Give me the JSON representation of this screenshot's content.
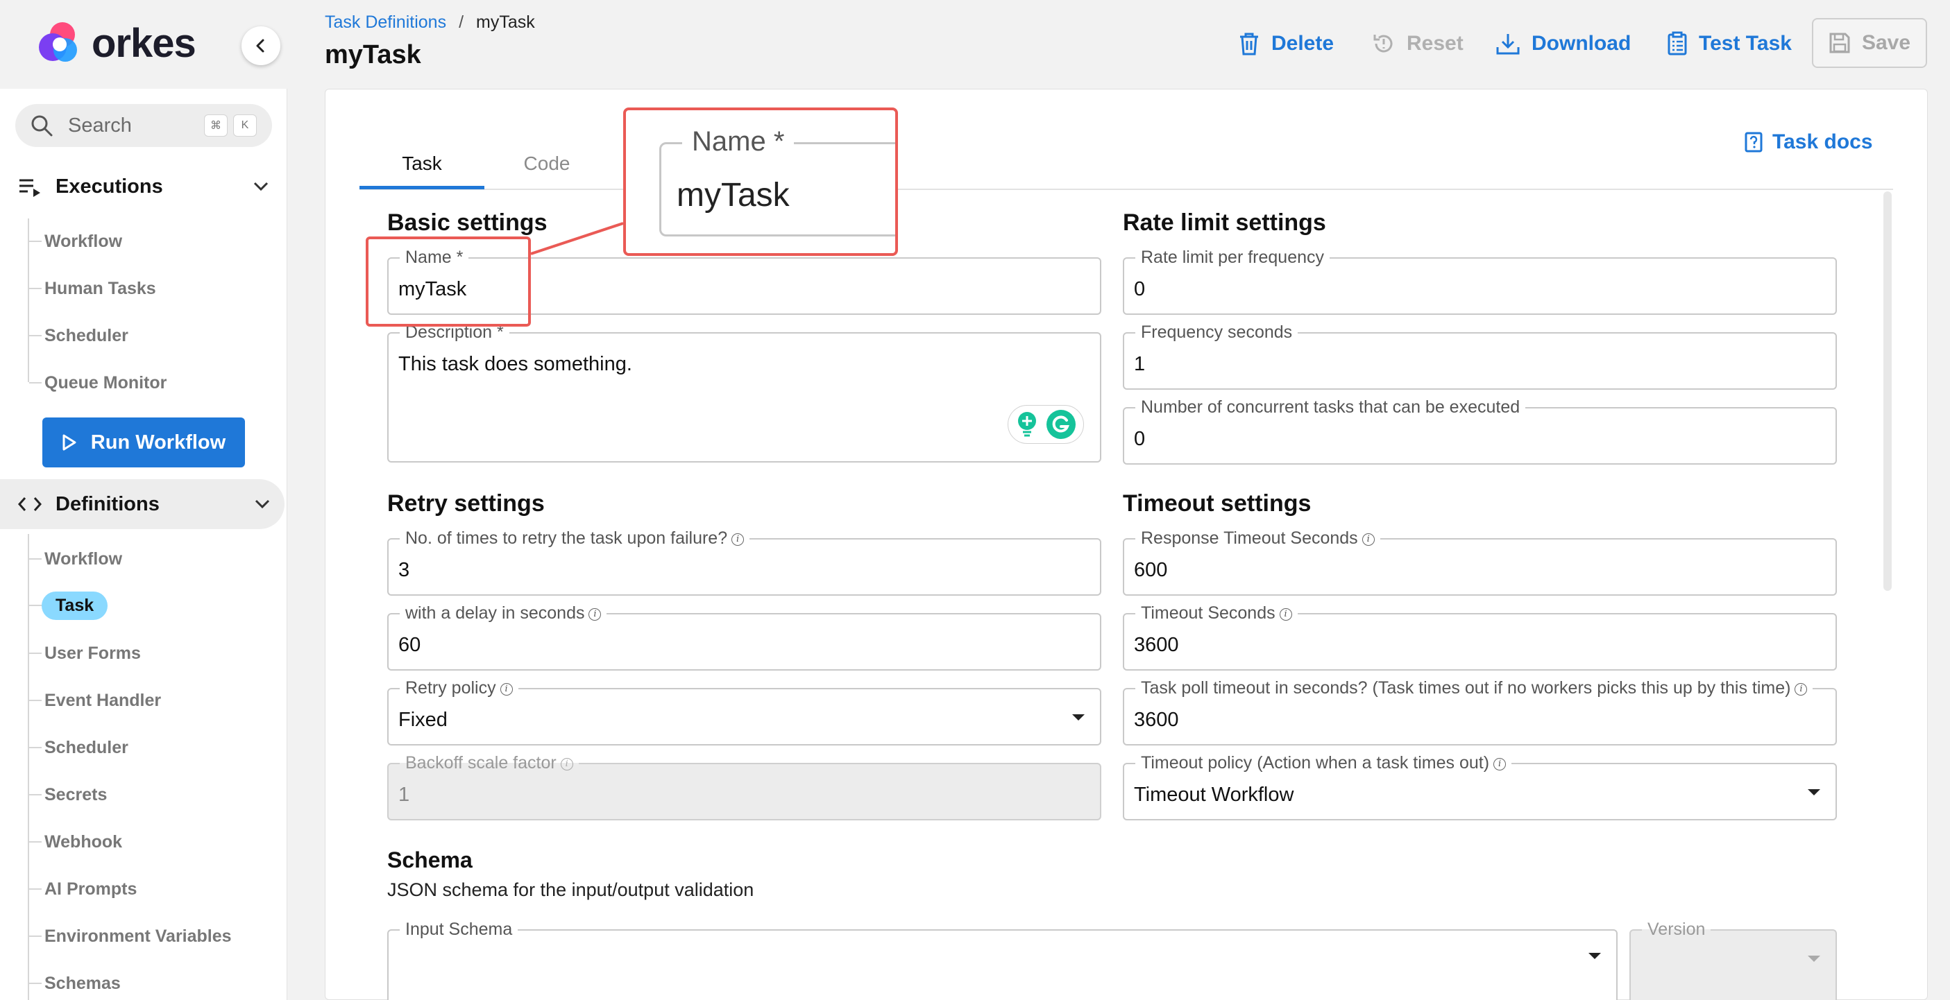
{
  "brand": {
    "name": "orkes"
  },
  "colors": {
    "accent": "#1f78d8",
    "active_nav_bg": "#8ad9ff",
    "callout": "#ea5a55"
  },
  "sidebar": {
    "search_placeholder": "Search",
    "shortcut_keys": [
      "⌘",
      "K"
    ],
    "executions": {
      "label": "Executions",
      "items": [
        "Workflow",
        "Human Tasks",
        "Scheduler",
        "Queue Monitor"
      ]
    },
    "run_workflow_label": "Run Workflow",
    "definitions": {
      "label": "Definitions",
      "items": [
        "Workflow",
        "Task",
        "User Forms",
        "Event Handler",
        "Scheduler",
        "Secrets",
        "Webhook",
        "AI Prompts",
        "Environment Variables",
        "Schemas"
      ],
      "active": "Task"
    }
  },
  "header": {
    "breadcrumb_link": "Task Definitions",
    "breadcrumb_sep": "/",
    "breadcrumb_current": "myTask",
    "title": "myTask",
    "actions": {
      "delete": "Delete",
      "reset": "Reset",
      "download": "Download",
      "test_task": "Test Task",
      "save": "Save"
    }
  },
  "tabs": {
    "task": "Task",
    "code": "Code",
    "active": "Task"
  },
  "task_docs": "Task docs",
  "basic": {
    "heading": "Basic settings",
    "name_label": "Name *",
    "name_value": "myTask",
    "description_label": "Description *",
    "description_value": "This task does something."
  },
  "rate_limit": {
    "heading": "Rate limit settings",
    "per_frequency_label": "Rate limit per frequency",
    "per_frequency_value": "0",
    "frequency_seconds_label": "Frequency seconds",
    "frequency_seconds_value": "1",
    "concurrent_label": "Number of concurrent tasks that can be executed",
    "concurrent_value": "0"
  },
  "retry": {
    "heading": "Retry settings",
    "count_label": "No. of times to retry the task upon failure?",
    "count_value": "3",
    "delay_label": "with a delay in seconds",
    "delay_value": "60",
    "policy_label": "Retry policy",
    "policy_value": "Fixed",
    "backoff_label": "Backoff scale factor",
    "backoff_value": "1"
  },
  "timeout": {
    "heading": "Timeout settings",
    "response_label": "Response Timeout Seconds",
    "response_value": "600",
    "timeout_label": "Timeout Seconds",
    "timeout_value": "3600",
    "poll_label": "Task poll timeout in seconds? (Task times out if no workers picks this up by this time)",
    "poll_value": "3600",
    "policy_label": "Timeout policy (Action when a task times out)",
    "policy_value": "Timeout Workflow"
  },
  "schema": {
    "heading": "Schema",
    "description": "JSON schema for the input/output validation",
    "input_label": "Input Schema",
    "version_label": "Version"
  },
  "callout": {
    "label": "Name *",
    "value": "myTask"
  }
}
